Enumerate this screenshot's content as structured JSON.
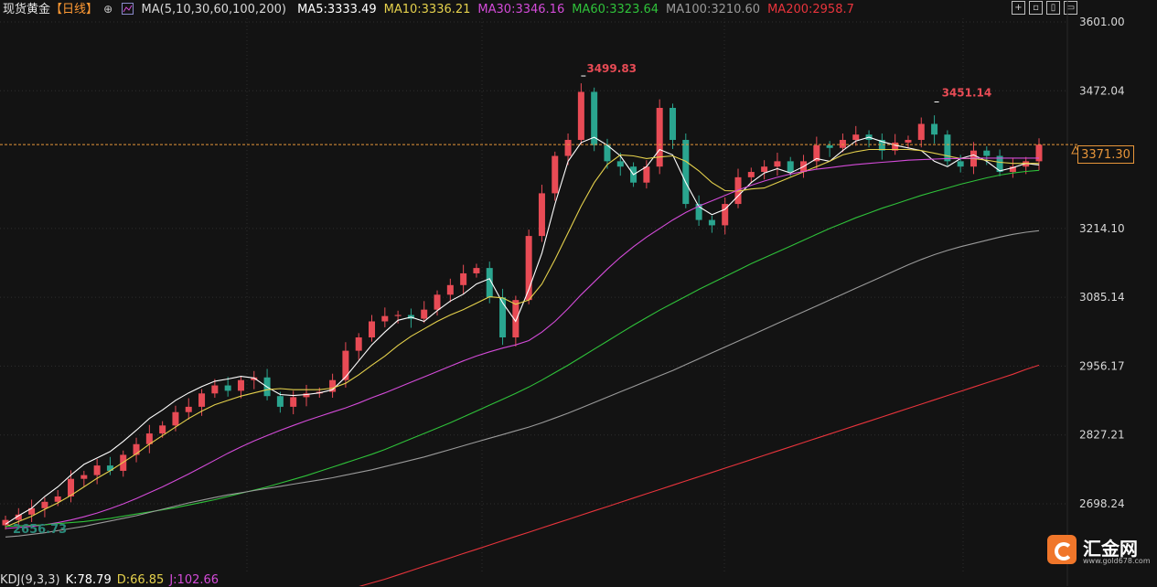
{
  "header": {
    "symbol": "现货黄金",
    "period": "【日线】",
    "ma_group": "MA(5,10,30,60,100,200)",
    "ma_values": [
      {
        "label": "MA5:3333.49",
        "color": "#ffffff"
      },
      {
        "label": "MA10:3336.21",
        "color": "#e5d14c"
      },
      {
        "label": "MA30:3346.16",
        "color": "#d44bd9"
      },
      {
        "label": "MA60:3323.64",
        "color": "#2fc23a"
      },
      {
        "label": "MA100:3210.60",
        "color": "#9a9a9a"
      },
      {
        "label": "MA200:2958.7",
        "color": "#e8343c"
      }
    ]
  },
  "toolbar": {
    "icons": [
      "expand-icon",
      "maximize-icon",
      "layout-icon",
      "fullscreen-icon"
    ]
  },
  "colors": {
    "up": "#e84b55",
    "down": "#2aa58f",
    "grid": "#2e2e2e",
    "price_line": "#e8963a"
  },
  "price_axis": {
    "ticks": [
      "3601.00",
      "3472.04",
      "3214.10",
      "3085.14",
      "2956.17",
      "2827.21",
      "2698.24"
    ],
    "current_price": "3371.30"
  },
  "chart_data": {
    "type": "candlestick",
    "ylim": [
      2640,
      3640
    ],
    "annotations": {
      "high_1": {
        "label": "3499.83",
        "value": 3499.83
      },
      "high_2": {
        "label": "3451.14",
        "value": 3451.14
      },
      "low": {
        "label": "2656.73",
        "value": 2656.73
      }
    },
    "series": [
      {
        "name": "MA5:3333.49",
        "color": "#ffffff",
        "values": [
          2660,
          2676,
          2690,
          2712,
          2730,
          2752,
          2772,
          2784,
          2796,
          2815,
          2836,
          2858,
          2874,
          2892,
          2906,
          2918,
          2928,
          2932,
          2937,
          2934,
          2917,
          2903,
          2901,
          2903,
          2906,
          2912,
          2936,
          2966,
          2996,
          3020,
          3042,
          3048,
          3040,
          3060,
          3078,
          3091,
          3110,
          3120,
          3075,
          3040,
          3100,
          3168,
          3260,
          3340,
          3375,
          3385,
          3370,
          3350,
          3315,
          3330,
          3362,
          3352,
          3300,
          3255,
          3240,
          3250,
          3275,
          3300,
          3318,
          3326,
          3318,
          3330,
          3345,
          3340,
          3360,
          3378,
          3385,
          3377,
          3370,
          3365,
          3360,
          3340,
          3330,
          3345,
          3352,
          3340,
          3322,
          3328,
          3336,
          3333
        ]
      },
      {
        "name": "MA10:3336.21",
        "color": "#e5d14c",
        "values": [
          2655,
          2665,
          2675,
          2688,
          2700,
          2714,
          2730,
          2746,
          2760,
          2776,
          2792,
          2810,
          2826,
          2842,
          2858,
          2872,
          2884,
          2892,
          2900,
          2906,
          2912,
          2914,
          2912,
          2912,
          2912,
          2915,
          2924,
          2940,
          2958,
          2975,
          2995,
          3012,
          3026,
          3040,
          3052,
          3062,
          3074,
          3086,
          3084,
          3072,
          3080,
          3110,
          3156,
          3206,
          3256,
          3300,
          3334,
          3352,
          3350,
          3345,
          3348,
          3350,
          3340,
          3322,
          3300,
          3285,
          3284,
          3288,
          3290,
          3300,
          3310,
          3320,
          3330,
          3340,
          3352,
          3358,
          3362,
          3362,
          3362,
          3362,
          3360,
          3355,
          3350,
          3345,
          3345,
          3342,
          3338,
          3336,
          3336,
          3336
        ]
      },
      {
        "name": "MA30:3346.16",
        "color": "#d44bd9",
        "values": [
          2652,
          2654,
          2656,
          2659,
          2663,
          2668,
          2674,
          2681,
          2689,
          2698,
          2708,
          2719,
          2730,
          2742,
          2754,
          2767,
          2780,
          2793,
          2805,
          2816,
          2826,
          2836,
          2845,
          2854,
          2862,
          2870,
          2878,
          2887,
          2897,
          2906,
          2916,
          2926,
          2936,
          2946,
          2956,
          2966,
          2975,
          2983,
          2990,
          2996,
          3004,
          3020,
          3040,
          3064,
          3090,
          3114,
          3138,
          3160,
          3180,
          3198,
          3214,
          3230,
          3244,
          3256,
          3266,
          3276,
          3286,
          3295,
          3303,
          3310,
          3316,
          3321,
          3325,
          3328,
          3331,
          3334,
          3336,
          3338,
          3340,
          3342,
          3343,
          3344,
          3345,
          3345,
          3346,
          3346,
          3346,
          3346,
          3346,
          3346
        ]
      },
      {
        "name": "MA60:3323.64",
        "color": "#2fc23a",
        "values": [
          2656,
          2657,
          2658,
          2659,
          2661,
          2663,
          2665,
          2668,
          2671,
          2675,
          2679,
          2683,
          2687,
          2691,
          2696,
          2701,
          2706,
          2712,
          2718,
          2724,
          2730,
          2737,
          2744,
          2751,
          2759,
          2767,
          2775,
          2783,
          2791,
          2800,
          2810,
          2820,
          2830,
          2840,
          2850,
          2861,
          2872,
          2883,
          2894,
          2905,
          2917,
          2930,
          2944,
          2958,
          2973,
          2988,
          3003,
          3018,
          3033,
          3047,
          3061,
          3074,
          3087,
          3100,
          3112,
          3124,
          3136,
          3148,
          3159,
          3170,
          3181,
          3192,
          3203,
          3214,
          3224,
          3234,
          3243,
          3252,
          3260,
          3268,
          3276,
          3283,
          3290,
          3297,
          3303,
          3309,
          3314,
          3318,
          3321,
          3323
        ]
      },
      {
        "name": "MA100:3210.60",
        "color": "#9a9a9a",
        "values": [
          2636,
          2638,
          2641,
          2644,
          2648,
          2652,
          2656,
          2661,
          2666,
          2671,
          2676,
          2682,
          2688,
          2694,
          2700,
          2705,
          2710,
          2715,
          2719,
          2723,
          2727,
          2731,
          2735,
          2739,
          2743,
          2747,
          2752,
          2757,
          2762,
          2768,
          2774,
          2780,
          2786,
          2793,
          2800,
          2807,
          2814,
          2821,
          2828,
          2835,
          2842,
          2850,
          2859,
          2868,
          2878,
          2888,
          2898,
          2908,
          2918,
          2928,
          2938,
          2948,
          2959,
          2970,
          2981,
          2992,
          3003,
          3014,
          3025,
          3036,
          3047,
          3058,
          3069,
          3080,
          3091,
          3102,
          3113,
          3124,
          3135,
          3146,
          3156,
          3165,
          3173,
          3180,
          3186,
          3192,
          3198,
          3203,
          3207,
          3210
        ]
      },
      {
        "name": "MA200:2958.7",
        "color": "#e8343c",
        "values": [
          null,
          null,
          null,
          null,
          null,
          null,
          null,
          null,
          null,
          null,
          null,
          null,
          null,
          null,
          null,
          null,
          null,
          null,
          null,
          null,
          null,
          null,
          null,
          2515,
          2522,
          2529,
          2536,
          2543,
          2550,
          2557,
          2565,
          2573,
          2581,
          2589,
          2597,
          2605,
          2613,
          2621,
          2629,
          2637,
          2645,
          2653,
          2661,
          2669,
          2677,
          2685,
          2693,
          2701,
          2709,
          2717,
          2725,
          2733,
          2741,
          2749,
          2757,
          2765,
          2773,
          2781,
          2789,
          2797,
          2805,
          2813,
          2821,
          2829,
          2837,
          2845,
          2853,
          2861,
          2869,
          2877,
          2885,
          2893,
          2901,
          2909,
          2917,
          2925,
          2933,
          2941,
          2950,
          2958
        ]
      }
    ],
    "candles_close": [
      2668,
      2678,
      2690,
      2702,
      2712,
      2745,
      2752,
      2770,
      2760,
      2790,
      2810,
      2830,
      2845,
      2870,
      2880,
      2905,
      2920,
      2910,
      2930,
      2935,
      2900,
      2880,
      2898,
      2905,
      2908,
      2930,
      2985,
      3010,
      3040,
      3050,
      3052,
      3045,
      3062,
      3090,
      3108,
      3130,
      3140,
      3085,
      3010,
      3080,
      3200,
      3280,
      3350,
      3380,
      3470,
      3370,
      3340,
      3330,
      3300,
      3330,
      3440,
      3380,
      3260,
      3230,
      3220,
      3260,
      3310,
      3320,
      3330,
      3340,
      3320,
      3340,
      3370,
      3365,
      3380,
      3390,
      3380,
      3360,
      3375,
      3380,
      3410,
      3390,
      3340,
      3330,
      3360,
      3350,
      3320,
      3330,
      3340,
      3371
    ]
  }
}
